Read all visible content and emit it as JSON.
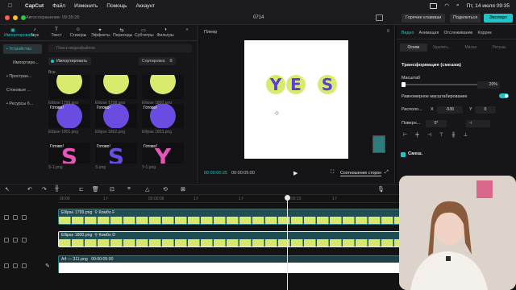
{
  "menubar": {
    "app": "CapCut",
    "items": [
      "Файл",
      "Изменить",
      "Помощь",
      "Аккаунт"
    ],
    "clock": "Пт, 14 июля 09:35"
  },
  "titlebar": {
    "autosave": "Автосохранение: 09:35:26",
    "project": "0714",
    "hotkeys": "Горячие клавиши",
    "share": "Поделиться",
    "export": "Экспорт"
  },
  "media": {
    "tabs": [
      {
        "label": "Импортировать",
        "icon": "▣"
      },
      {
        "label": "Звук",
        "icon": "♪"
      },
      {
        "label": "Текст",
        "icon": "T"
      },
      {
        "label": "Стикеры",
        "icon": "☺"
      },
      {
        "label": "Эффекты",
        "icon": "✦"
      },
      {
        "label": "Переходы",
        "icon": "⇆"
      },
      {
        "label": "Субтитры",
        "icon": "▭"
      },
      {
        "label": "Фильтры",
        "icon": "◑"
      }
    ],
    "more": "»",
    "side": [
      "• Устройство",
      "Импортиро...",
      "• Простран...",
      "Стоковые ...",
      "• Ресурсы б..."
    ],
    "search_placeholder": "Поиск медиафайлов",
    "import_label": "Импортировать",
    "sort_label": "Сортировка",
    "all_label": "Все",
    "ready": "Готово!",
    "files": [
      {
        "name": "Ellipse 1799.png",
        "color": "#d9ea6d",
        "shape": "circle"
      },
      {
        "name": "Ellipse 1798.png",
        "color": "#d9ea6d",
        "shape": "circle"
      },
      {
        "name": "Ellipse 1800.png",
        "color": "#d9ea6d",
        "shape": "circle"
      },
      {
        "name": "Ellipse 1801.png",
        "color": "#6a4de0",
        "shape": "circle"
      },
      {
        "name": "Ellipse 1802.png",
        "color": "#6a4de0",
        "shape": "circle"
      },
      {
        "name": "Ellipse 1803.png",
        "color": "#6a4de0",
        "shape": "circle"
      },
      {
        "name": "S-1.png",
        "color": "#e655b8",
        "shape": "S"
      },
      {
        "name": "S.png",
        "color": "#6a4de0",
        "shape": "S"
      },
      {
        "name": "Y-1.png",
        "color": "#e655b8",
        "shape": "Y"
      }
    ]
  },
  "player": {
    "label": "Плеер",
    "letters": [
      {
        "char": "Y",
        "bg": "#d9ea6d",
        "fg": "#5b3fd6"
      },
      {
        "char": "E",
        "bg": "#d9ea6d",
        "fg": "#5b3fd6"
      },
      {
        "char": "S",
        "bg": "#d9ea6d",
        "fg": "#5b3fd6"
      }
    ],
    "timecode": "00:00:00:25",
    "duration": "00:00:05:00",
    "ratio": "Соотношение сторон"
  },
  "inspector": {
    "tabs": [
      "Видео",
      "Анимация",
      "Отслеживание",
      "Коррек"
    ],
    "subtabs": [
      "Основ",
      "Удалить...",
      "Маска",
      "Ретушь"
    ],
    "transform": "Трансформация (смешка)",
    "scale_label": "Масштаб",
    "scale_value": "20%",
    "uniform": "Равномерное масштабирование",
    "position_label": "Располо...",
    "x_label": "X",
    "x_value": "-536",
    "y_label": "Y",
    "y_value": "0",
    "rotate_label": "Поверн...",
    "rotate_value": "0°",
    "blend": "Смеш."
  },
  "timeline": {
    "ruler": [
      "00:00",
      "1 f",
      "00:00:08",
      "1:f",
      "1 f",
      "00:00:10",
      "1 f"
    ],
    "tracks": [
      {
        "label": "Ellipse 1799.png",
        "combo": "Комбо F"
      },
      {
        "label": "Ellipse 1800.png",
        "combo": "Комбо D"
      }
    ],
    "main": {
      "label": "А4 — 311.png",
      "duration": "00:00:05:00"
    }
  },
  "accent": "#1ec4c7"
}
